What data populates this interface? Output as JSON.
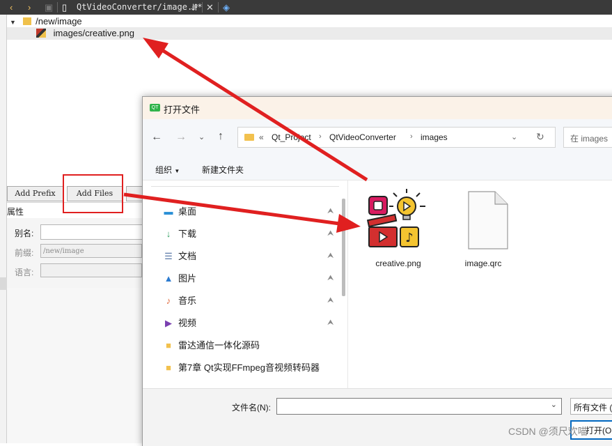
{
  "toolbar": {
    "tab_title": "QtVideoConverter/image.⋯*",
    "close_symbol": "✕",
    "back_symbol": "‹",
    "forward_symbol": "›",
    "updown_symbol": "⇵"
  },
  "tree": {
    "root_label": "/new/image",
    "child_label": "images/creative.png",
    "expand_symbol": "▼"
  },
  "panel": {
    "add_prefix_label": "Add Prefix",
    "add_files_label": "Add Files",
    "properties_title": "属性",
    "alias_label": "别名:",
    "prefix_label": "前缀:",
    "prefix_value": "/new/image",
    "language_label": "语言:"
  },
  "dialog": {
    "title": "打开文件",
    "app_badge": "QT",
    "path": [
      "«",
      "Qt_Project",
      "QtVideoConverter",
      "images"
    ],
    "search_placeholder": "在 images",
    "organize_label": "组织",
    "new_folder_label": "新建文件夹",
    "sidebar": [
      {
        "label": "桌面",
        "icon": "desktop-icon",
        "glyph": "▬",
        "color": "#2a8fd6",
        "pinned": true
      },
      {
        "label": "下载",
        "icon": "download-icon",
        "glyph": "↓",
        "color": "#2a9d5c",
        "pinned": true
      },
      {
        "label": "文档",
        "icon": "document-icon",
        "glyph": "☰",
        "color": "#5b7aa8",
        "pinned": true
      },
      {
        "label": "图片",
        "icon": "pictures-icon",
        "glyph": "▲",
        "color": "#2c7bd0",
        "pinned": true
      },
      {
        "label": "音乐",
        "icon": "music-icon",
        "glyph": "♪",
        "color": "#e0683a",
        "pinned": true
      },
      {
        "label": "视频",
        "icon": "video-icon",
        "glyph": "▶",
        "color": "#7a3fb0",
        "pinned": true
      },
      {
        "label": "雷达通信一体化源码",
        "icon": "folder-icon",
        "glyph": "■",
        "color": "#f2c14e",
        "pinned": false
      },
      {
        "label": "第7章 Qt实现FFmpeg音视频转码器",
        "icon": "folder-icon",
        "glyph": "■",
        "color": "#f2c14e",
        "pinned": false
      }
    ],
    "files": [
      {
        "name": "creative.png",
        "icon": "creative-image-icon"
      },
      {
        "name": "image.qrc",
        "icon": "blank-file-icon"
      }
    ],
    "filename_label": "文件名(N):",
    "filename_value": "",
    "filter_label": "所有文件 (",
    "open_label": "打开(O"
  },
  "watermark": "CSDN @须尺欢喵",
  "colors": {
    "highlight_red": "#e02020",
    "toolbar_bg": "#3a3a3a",
    "dialog_title_bg": "#fbf2e8"
  }
}
